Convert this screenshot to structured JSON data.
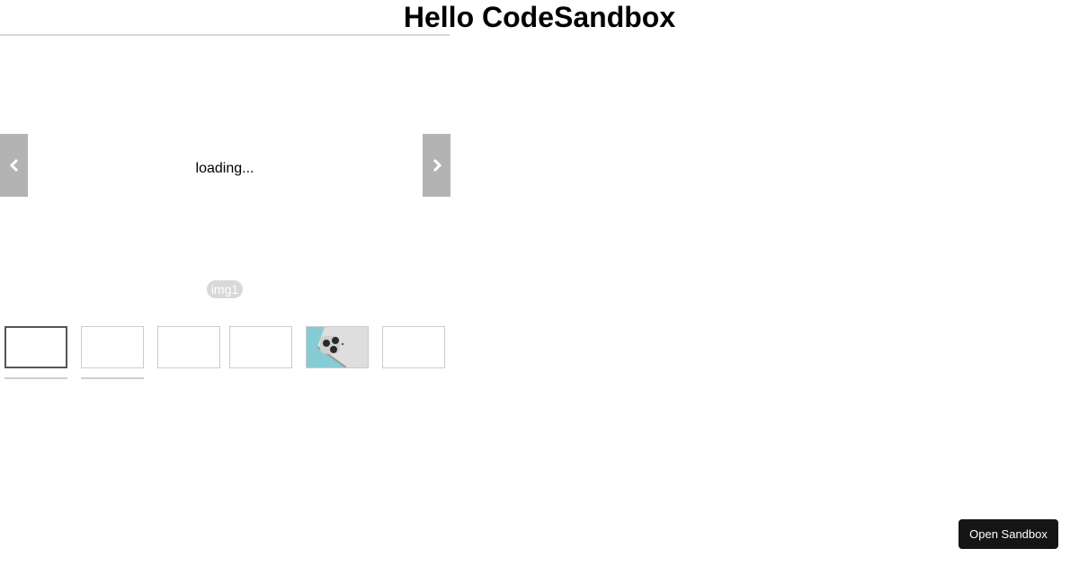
{
  "page": {
    "title": "Hello CodeSandbox"
  },
  "slider": {
    "prev_icon": "chevron-left-icon",
    "next_icon": "chevron-right-icon",
    "loading_text": "loading...",
    "caption": "img1",
    "thumbnails": [
      {
        "active": true,
        "image": "none"
      },
      {
        "active": false,
        "image": "none"
      },
      {
        "active": false,
        "image": "none"
      },
      {
        "active": false,
        "image": "none"
      },
      {
        "active": false,
        "image": "phone-photo"
      },
      {
        "active": false,
        "image": "none"
      }
    ]
  },
  "footer": {
    "open_sandbox_label": "Open Sandbox"
  },
  "colors": {
    "arrow_bg": "#b3b3b3",
    "phone_bg": "#86ccd4",
    "button_bg": "#151515"
  }
}
